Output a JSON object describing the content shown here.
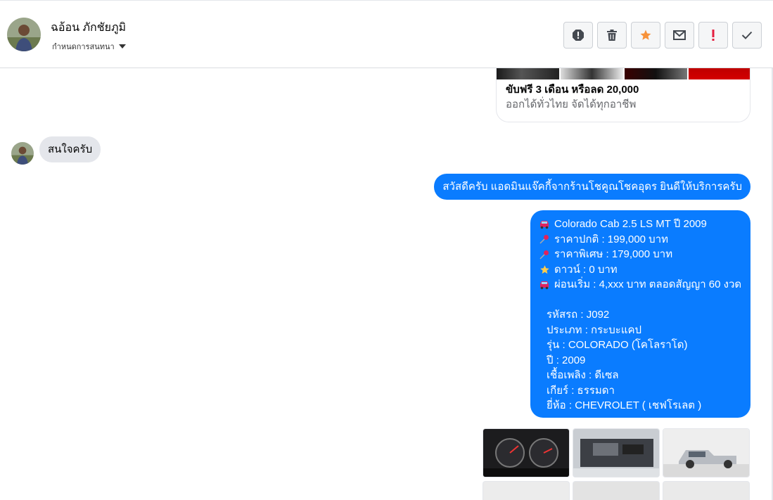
{
  "header": {
    "contact_name": "ฉอ้อน ภักชัยภูมิ",
    "subtitle": "กำหนดการสนทนา"
  },
  "actions": [
    {
      "icon": "alert-circle-icon",
      "color": "#444950"
    },
    {
      "icon": "trash-icon",
      "color": "#444950"
    },
    {
      "icon": "star-icon",
      "color": "#f7923a"
    },
    {
      "icon": "envelope-icon",
      "color": "#444950"
    },
    {
      "icon": "exclamation-icon",
      "color": "#e41e3f"
    },
    {
      "icon": "check-icon",
      "color": "#444950"
    }
  ],
  "card": {
    "title": "ขับฟรี 3 เดือน หรือลด 20,000",
    "description": "ออกได้ทั่วไทย จัดได้ทุกอาชีพ"
  },
  "messages": {
    "incoming": "สนใจครับ",
    "greeting": "สวัสดีครับ แอดมินแจ๊คกี้จากร้านโชคูณโชคอุดร ยินดีให้บริการครับ",
    "detail_lines": [
      {
        "icon": "car-icon",
        "text": "Colorado Cab 2.5 LS MT ปี 2009"
      },
      {
        "icon": "pushpin-icon",
        "text": "ราคาปกติ : 199,000 บาท"
      },
      {
        "icon": "pushpin-icon",
        "text": "ราคาพิเศษ : 179,000 บาท"
      },
      {
        "icon": "star-icon",
        "text": "ดาวน์ : 0 บาท"
      },
      {
        "icon": "car-icon",
        "text": "ผ่อนเริ่ม : 4,xxx บาท ตลอดสัญญา 60 งวด"
      }
    ],
    "spec_lines": [
      "รหัสรถ : J092",
      "ประเภท : กระบะแคป",
      "รุ่น : COLORADO (โคโลราโด)",
      "ปี : 2009",
      "เชื้อเพลิง : ดีเซล",
      "เกียร์ : ธรรมดา",
      "ยี่ห้อ : CHEVROLET ( เชฟโรเลต )"
    ]
  },
  "colors": {
    "outgoing_bubble": "#0a7cff",
    "incoming_bubble": "#e4e6eb",
    "star_accent": "#f7923a",
    "alert_red": "#e41e3f"
  }
}
